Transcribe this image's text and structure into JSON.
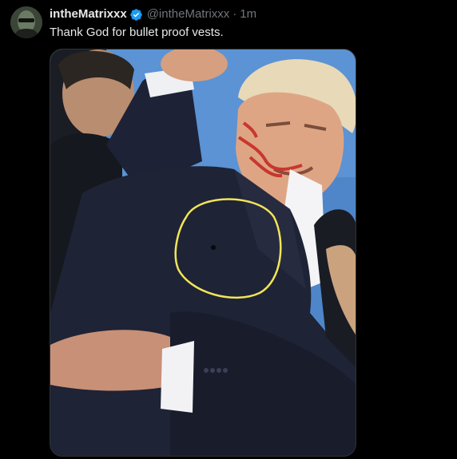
{
  "tweet": {
    "display_name": "intheMatrixxx",
    "handle": "@intheMatrixxx",
    "separator": "·",
    "time": "1m",
    "text": "Thank God for bullet proof vests.",
    "verified_icon": "verified-badge-icon",
    "verified_color": "#1d9bf0"
  },
  "media": {
    "annotation": "yellow-circle-highlight",
    "annotation_color": "#f2e45a"
  },
  "colors": {
    "background": "#000000",
    "primary_text": "#e7e9ea",
    "secondary_text": "#71767b"
  }
}
